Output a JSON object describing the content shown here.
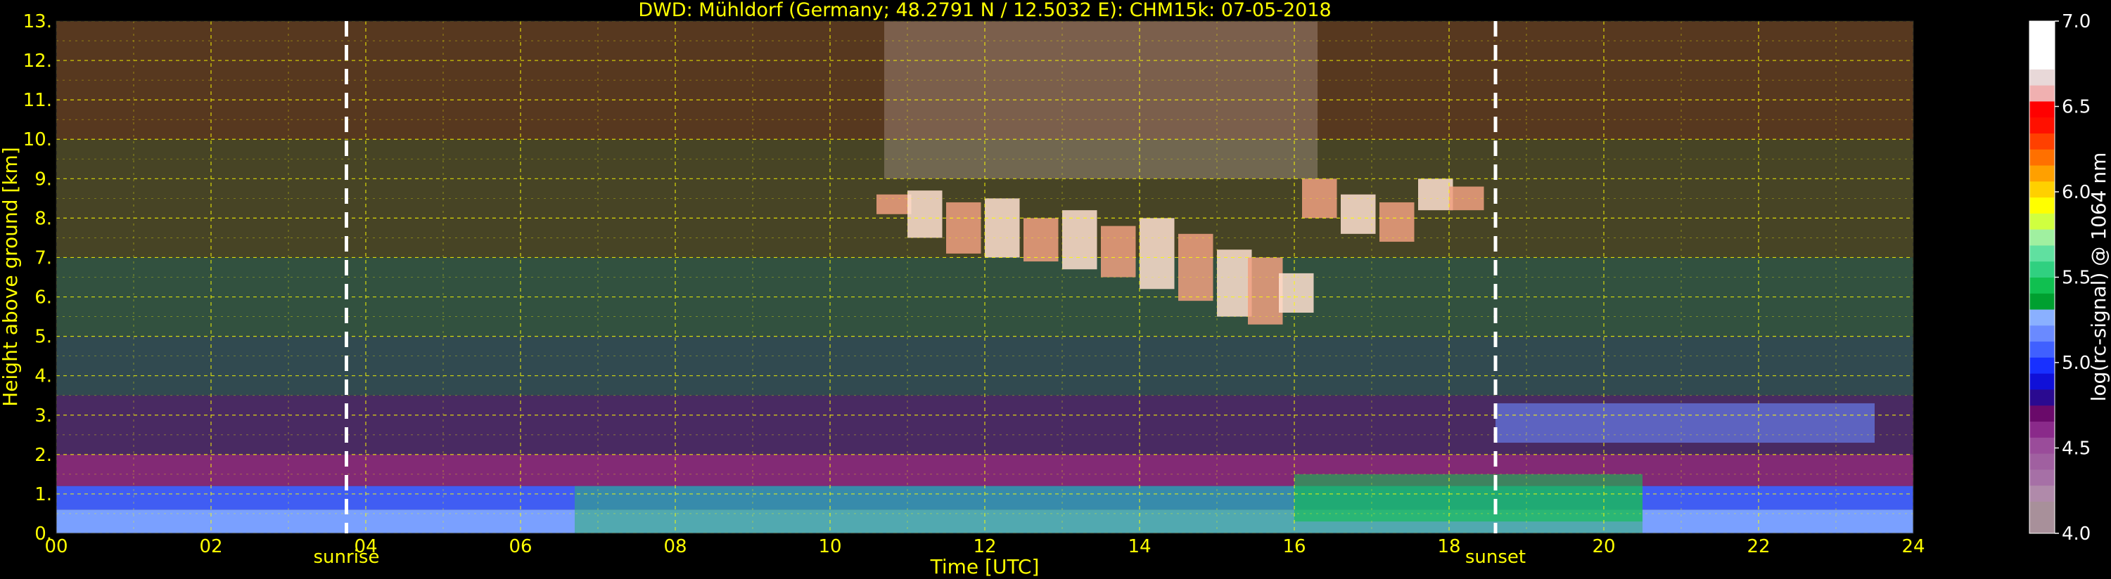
{
  "colors": {
    "background": "#000000",
    "text": "#ffff00",
    "grid": "#ffff00",
    "colorbar_text": "#ffffff",
    "sun_lines": "#ffffff"
  },
  "chart_data": {
    "type": "heatmap",
    "title": "DWD: Mühldorf (Germany; 48.2791 N / 12.5032 E):    CHM15k: 07-05-2018",
    "xlabel": "Time [UTC]",
    "ylabel": "Height above ground [km]",
    "colorbar_label": "log(rc-signal) @ 1064 nm",
    "xlim": [
      0,
      24
    ],
    "ylim": [
      0,
      13
    ],
    "clim": [
      4.0,
      7.0
    ],
    "grid": true,
    "x_ticks": [
      {
        "value": 0,
        "label": "00"
      },
      {
        "value": 2,
        "label": "02"
      },
      {
        "value": 4,
        "label": "04"
      },
      {
        "value": 6,
        "label": "06"
      },
      {
        "value": 8,
        "label": "08"
      },
      {
        "value": 10,
        "label": "10"
      },
      {
        "value": 12,
        "label": "12"
      },
      {
        "value": 14,
        "label": "14"
      },
      {
        "value": 16,
        "label": "16"
      },
      {
        "value": 18,
        "label": "18"
      },
      {
        "value": 20,
        "label": "20"
      },
      {
        "value": 22,
        "label": "22"
      },
      {
        "value": 24,
        "label": "24"
      }
    ],
    "y_ticks": [
      {
        "value": 0,
        "label": "0."
      },
      {
        "value": 1,
        "label": "1."
      },
      {
        "value": 2,
        "label": "2."
      },
      {
        "value": 3,
        "label": "3."
      },
      {
        "value": 4,
        "label": "4."
      },
      {
        "value": 5,
        "label": "5."
      },
      {
        "value": 6,
        "label": "6."
      },
      {
        "value": 7,
        "label": "7."
      },
      {
        "value": 8,
        "label": "8."
      },
      {
        "value": 9,
        "label": "9."
      },
      {
        "value": 10,
        "label": "10."
      },
      {
        "value": 11,
        "label": "11."
      },
      {
        "value": 12,
        "label": "12."
      },
      {
        "value": 13,
        "label": "13."
      }
    ],
    "colorbar_ticks": [
      {
        "value": 4.0,
        "label": "4.0"
      },
      {
        "value": 4.5,
        "label": "4.5"
      },
      {
        "value": 5.0,
        "label": "5.0"
      },
      {
        "value": 5.5,
        "label": "5.5"
      },
      {
        "value": 6.0,
        "label": "6.0"
      },
      {
        "value": 6.5,
        "label": "6.5"
      },
      {
        "value": 7.0,
        "label": "7.0"
      }
    ],
    "colorbar_colors": [
      "#a8909a",
      "#a8909a",
      "#b08aaa",
      "#a670a6",
      "#a060a0",
      "#9a4c9a",
      "#8a2a8a",
      "#6a0a6a",
      "#2a0a90",
      "#1010d8",
      "#1830ff",
      "#4060ff",
      "#6a8aff",
      "#8ab0ff",
      "#00a030",
      "#10c050",
      "#30d080",
      "#60e0a0",
      "#a0f0a0",
      "#d0ff40",
      "#ffff00",
      "#ffd000",
      "#ffa000",
      "#ff7000",
      "#ff4000",
      "#ff1000",
      "#ff0000",
      "#f0b0b0",
      "#e8d8d8",
      "#ffffff",
      "#ffffff",
      "#ffffff"
    ],
    "events": [
      {
        "name": "sunrise",
        "time": 3.75
      },
      {
        "name": "sunset",
        "time": 18.6
      }
    ]
  }
}
